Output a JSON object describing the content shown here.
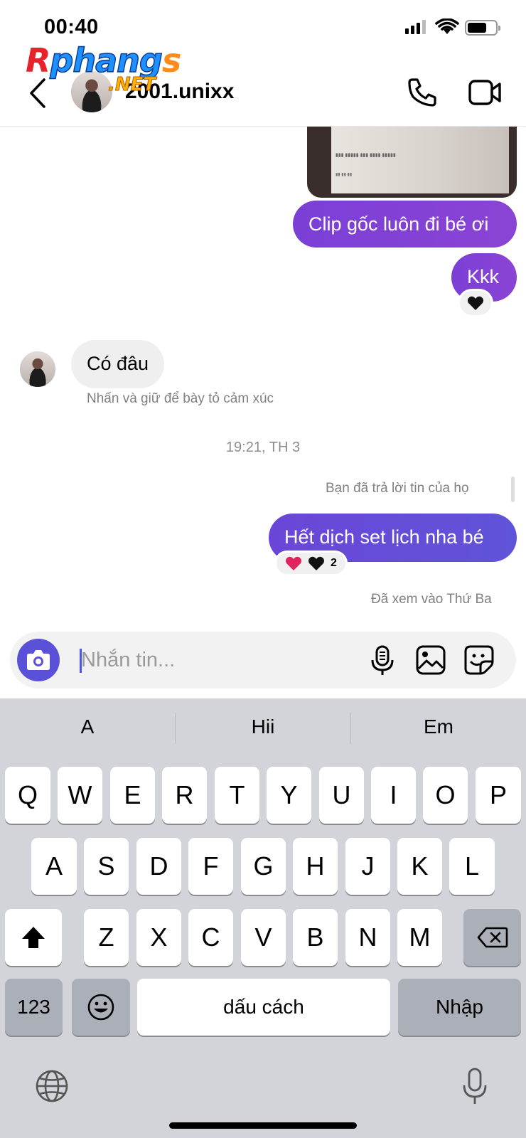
{
  "status_bar": {
    "time": "00:40"
  },
  "watermark": {
    "main": "Rphangs",
    "sub": ".NET"
  },
  "header": {
    "username": "2001.unixx"
  },
  "messages": {
    "msg1": "Clip gốc luôn đi bé ơi",
    "msg2": "Kkk",
    "msg3": "Có đâu",
    "msg3_hint": "Nhấn và giữ để bày tỏ cảm xúc",
    "timestamp": "19:21, TH 3",
    "reply_note": "Bạn đã trả lời tin của họ",
    "msg4": "Hết dịch set lịch nha bé",
    "msg4_reaction_count": "2",
    "seen": "Đã xem vào Thứ Ba"
  },
  "composer": {
    "placeholder": "Nhắn tin..."
  },
  "keyboard": {
    "suggestions": [
      "A",
      "Hii",
      "Em"
    ],
    "row1": [
      "Q",
      "W",
      "E",
      "R",
      "T",
      "Y",
      "U",
      "I",
      "O",
      "P"
    ],
    "row2": [
      "A",
      "S",
      "D",
      "F",
      "G",
      "H",
      "J",
      "K",
      "L"
    ],
    "row3": [
      "Z",
      "X",
      "C",
      "V",
      "B",
      "N",
      "M"
    ],
    "numbers_key": "123",
    "space_key": "dấu cách",
    "return_key": "Nhập"
  },
  "colors": {
    "outgoing_bubble": "#7b3fd6",
    "camera_button": "#5b51d8",
    "heart_red": "#e0245e",
    "heart_black": "#111111"
  }
}
